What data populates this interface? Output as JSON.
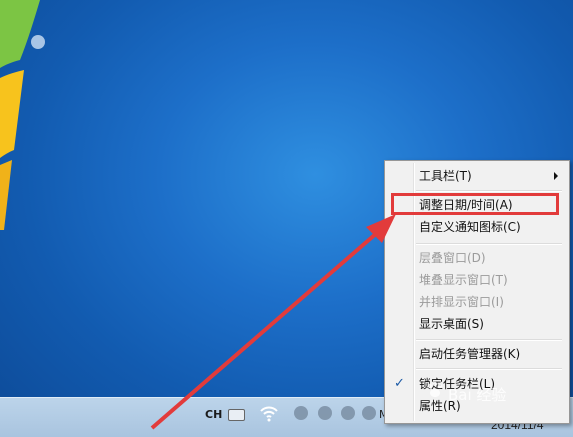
{
  "taskbar": {
    "language": "CH",
    "extra_label": "M",
    "date": "2014/11/4"
  },
  "watermark": "Bai 经验",
  "context_menu": {
    "items": [
      {
        "label": "工具栏(T)",
        "enabled": true,
        "submenu": true
      },
      {
        "label": "调整日期/时间(A)",
        "enabled": true,
        "highlighted": true
      },
      {
        "label": "自定义通知图标(C)",
        "enabled": true
      },
      {
        "label": "层叠窗口(D)",
        "enabled": false
      },
      {
        "label": "堆叠显示窗口(T)",
        "enabled": false
      },
      {
        "label": "并排显示窗口(I)",
        "enabled": false
      },
      {
        "label": "显示桌面(S)",
        "enabled": true
      },
      {
        "label": "启动任务管理器(K)",
        "enabled": true
      },
      {
        "label": "锁定任务栏(L)",
        "enabled": true,
        "checked": true
      },
      {
        "label": "属性(R)",
        "enabled": true
      }
    ]
  },
  "colors": {
    "desktop": "#1d6fc9",
    "highlight_box": "#e23b3b",
    "annotation_arrow": "#e23b3b"
  },
  "icons": [
    "windows-logo-icon",
    "keyboard-icon",
    "wifi-icon",
    "submenu-arrow-icon",
    "checkmark-icon"
  ]
}
